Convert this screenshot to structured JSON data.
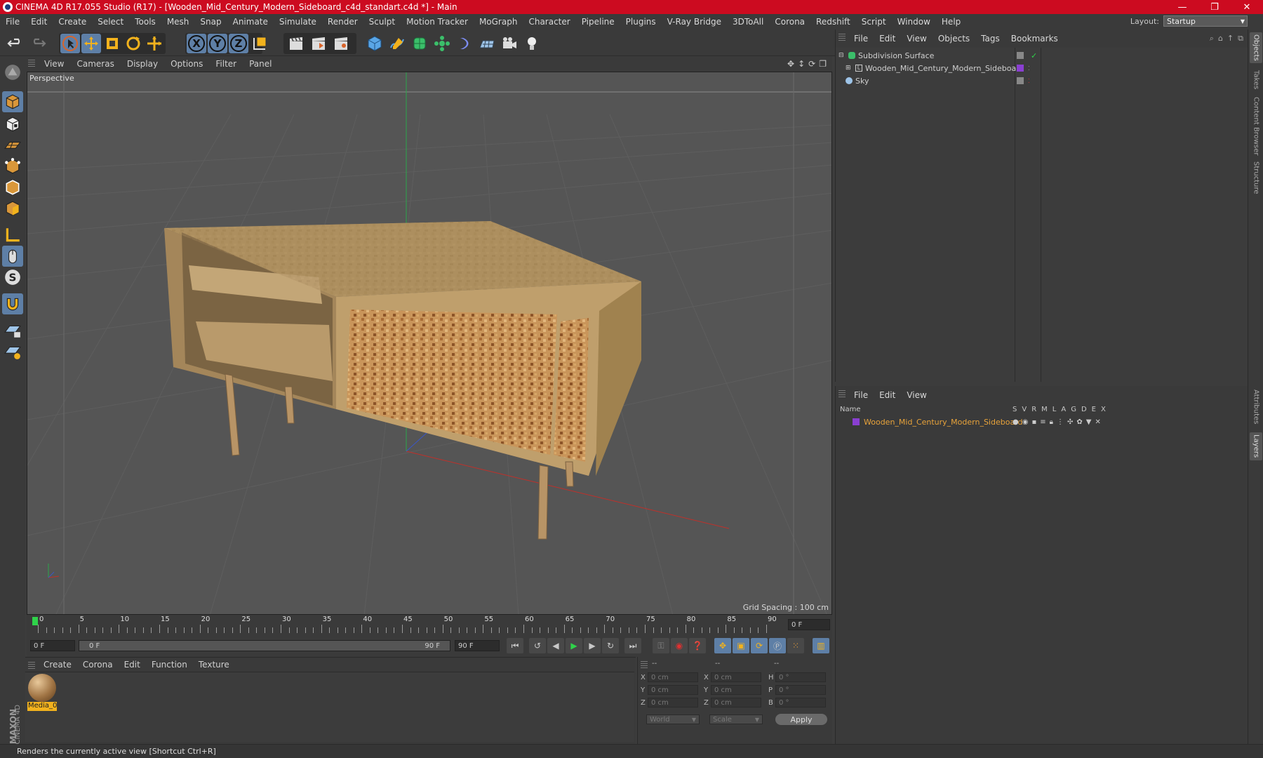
{
  "window": {
    "title": "CINEMA 4D R17.055 Studio (R17) - [Wooden_Mid_Century_Modern_Sideboard_c4d_standart.c4d *] - Main",
    "controls": [
      "—",
      "❐",
      "✕"
    ]
  },
  "menubar": {
    "items": [
      "File",
      "Edit",
      "Create",
      "Select",
      "Tools",
      "Mesh",
      "Snap",
      "Animate",
      "Simulate",
      "Render",
      "Sculpt",
      "Motion Tracker",
      "MoGraph",
      "Character",
      "Pipeline",
      "Plugins",
      "V-Ray Bridge",
      "3DToAll",
      "Corona",
      "Redshift",
      "Script",
      "Window",
      "Help"
    ],
    "layout_label": "Layout:",
    "layout_value": "Startup"
  },
  "toolbar": {
    "axis_x": "X",
    "axis_y": "Y",
    "axis_z": "Z"
  },
  "viewport": {
    "menu": [
      "View",
      "Cameras",
      "Display",
      "Options",
      "Filter",
      "Panel"
    ],
    "label": "Perspective",
    "grid_spacing": "Grid Spacing : 100 cm"
  },
  "timeline": {
    "ticks": [
      "0",
      "5",
      "10",
      "15",
      "20",
      "25",
      "30",
      "35",
      "40",
      "45",
      "50",
      "55",
      "60",
      "65",
      "70",
      "75",
      "80",
      "85",
      "90"
    ],
    "current_frame": "0 F",
    "start_field": "0 F",
    "slider_start": "0 F",
    "slider_end": "90 F",
    "end_field": "90 F"
  },
  "material_panel": {
    "menu": [
      "Create",
      "Corona",
      "Edit",
      "Function",
      "Texture"
    ],
    "material_name": "Media_0"
  },
  "coord_panel": {
    "headers": [
      "--",
      "--",
      "--"
    ],
    "labels_col1": [
      "X",
      "Y",
      "Z"
    ],
    "labels_col2": [
      "X",
      "Y",
      "Z"
    ],
    "labels_col3": [
      "H",
      "P",
      "B"
    ],
    "values_col1": [
      "0 cm",
      "0 cm",
      "0 cm"
    ],
    "values_col2": [
      "0 cm",
      "0 cm",
      "0 cm"
    ],
    "values_col3": [
      "0 °",
      "0 °",
      "0 °"
    ],
    "dropdown1": "World",
    "dropdown2": "Scale",
    "apply_label": "Apply"
  },
  "object_manager": {
    "menu": [
      "File",
      "Edit",
      "View",
      "Objects",
      "Tags",
      "Bookmarks"
    ],
    "objects": [
      {
        "name": "Subdivision Surface",
        "indent": 0
      },
      {
        "name": "Wooden_Mid_Century_Modern_Sideboard",
        "indent": 1
      },
      {
        "name": "Sky",
        "indent": 0
      }
    ]
  },
  "layer_manager": {
    "menu": [
      "File",
      "Edit",
      "View"
    ],
    "name_header": "Name",
    "col_headers": [
      "S",
      "V",
      "R",
      "M",
      "L",
      "A",
      "G",
      "D",
      "E",
      "X"
    ],
    "layer_name": "Wooden_Mid_Century_Modern_Sideboard"
  },
  "right_tabs": [
    "Objects",
    "Takes",
    "Content Browser",
    "Structure",
    "Attributes",
    "Layers"
  ],
  "brand": [
    "MAXON",
    "CINEMA 4D"
  ],
  "status": "Renders the currently active view [Shortcut Ctrl+R]",
  "colors": {
    "titlebar": "#cc0b20",
    "accent_blue": "#5e7fa6",
    "layer_orange": "#e8a33a",
    "layer_purple": "#8a3fd1",
    "axis_x": "#c0302a",
    "axis_y": "#2aa84a",
    "axis_z": "#3a56c8"
  }
}
